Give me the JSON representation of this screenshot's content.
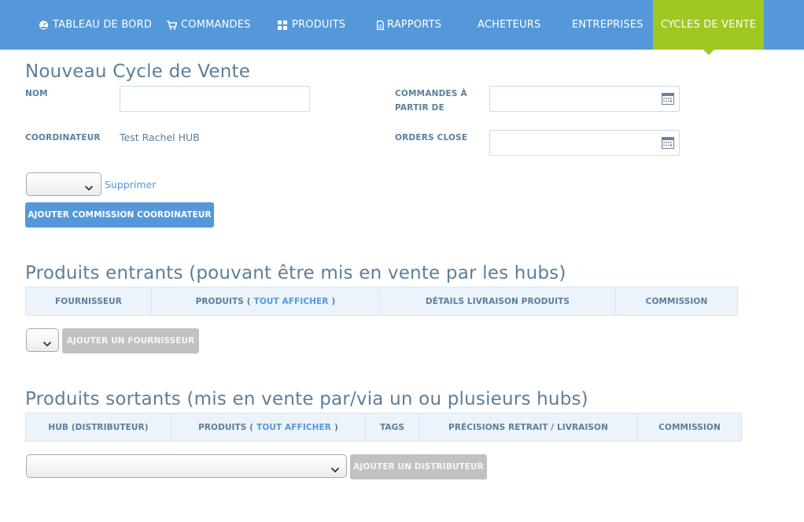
{
  "nav": {
    "items": [
      {
        "label": "TABLEAU DE BORD",
        "icon": "dashboard-icon"
      },
      {
        "label": "COMMANDES",
        "icon": "cart-icon"
      },
      {
        "label": "PRODUITS",
        "icon": "grid-icon"
      },
      {
        "label": "RAPPORTS",
        "icon": "document-icon"
      },
      {
        "label": "ACHETEURS",
        "icon": ""
      },
      {
        "label": "ENTREPRISES",
        "icon": ""
      },
      {
        "label": "CYCLES DE VENTE",
        "icon": "",
        "active": true
      }
    ]
  },
  "page": {
    "title": "Nouveau Cycle de Vente"
  },
  "form": {
    "name_label": "NOM",
    "name_value": "",
    "orders_open_label_line1": "COMMANDES À",
    "orders_open_label_line2": "PARTIR DE",
    "orders_open_value": "",
    "coordinator_label": "COORDINATEUR",
    "coordinator_value": "Test Rachel HUB",
    "orders_close_label": "ORDERS CLOSE",
    "orders_close_value": "",
    "fee_select_value": "",
    "delete_link": "Supprimer",
    "add_fee_button": "AJOUTER COMMISSION COORDINATEUR"
  },
  "incoming": {
    "title": "Produits entrants (pouvant être mis en vente par les hubs)",
    "columns": {
      "supplier": "FOURNISSEUR",
      "products_prefix": "PRODUITS (",
      "products_link": "TOUT AFFICHER",
      "products_suffix": ")",
      "delivery": "DÉTAILS LIVRAISON PRODUITS",
      "fees": "COMMISSION"
    },
    "supplier_select_value": "",
    "add_button": "AJOUTER UN FOURNISSEUR"
  },
  "outgoing": {
    "title": "Produits sortants (mis en vente par/via un ou plusieurs hubs)",
    "columns": {
      "hub": "HUB (DISTRIBUTEUR)",
      "products_prefix": "PRODUITS (",
      "products_link": "TOUT AFFICHER",
      "products_suffix": ")",
      "tags": "TAGS",
      "pickup": "PRÉCISIONS RETRAIT / LIVRAISON",
      "fees": "COMMISSION"
    },
    "distributor_select_value": "",
    "add_button": "AJOUTER UN DISTRIBUTEUR"
  },
  "colors": {
    "nav_bg": "#5498da",
    "nav_active": "#9fc820",
    "heading": "#5b7f9b",
    "link": "#5498da",
    "button_disabled": "#c1c1c1"
  }
}
